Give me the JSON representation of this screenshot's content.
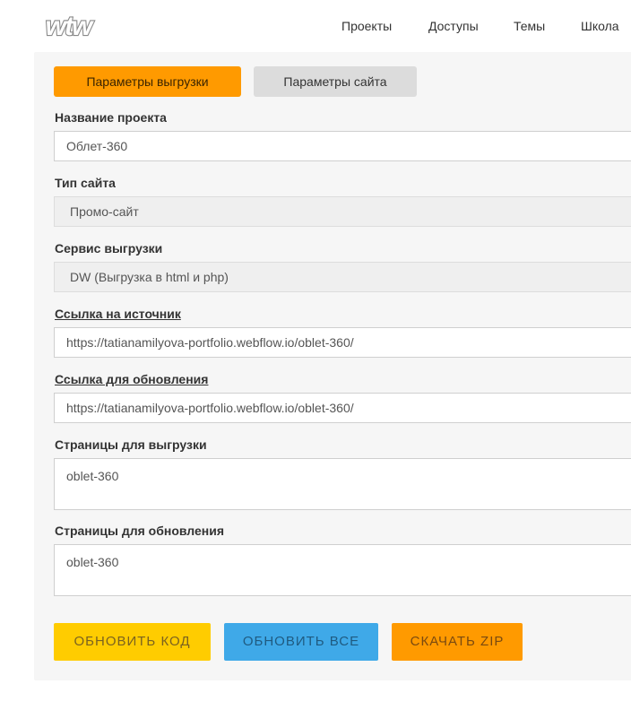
{
  "header": {
    "logo_text": "WTW",
    "nav": [
      "Проекты",
      "Доступы",
      "Темы",
      "Школа"
    ]
  },
  "tabs": {
    "export": "Параметры выгрузки",
    "site": "Параметры сайта"
  },
  "form": {
    "project_name": {
      "label": "Название проекта",
      "value": "Облет-360"
    },
    "site_type": {
      "label": "Тип сайта",
      "value": "Промо-сайт"
    },
    "export_service": {
      "label": "Сервис выгрузки",
      "value": "DW (Выгрузка в html и php)"
    },
    "source_link": {
      "label": "Ссылка на источник",
      "value": "https://tatianamilyova-portfolio.webflow.io/oblet-360/"
    },
    "update_link": {
      "label": "Ссылка для обновления",
      "value": "https://tatianamilyova-portfolio.webflow.io/oblet-360/"
    },
    "export_pages": {
      "label": "Страницы для выгрузки",
      "value": "oblet-360"
    },
    "update_pages": {
      "label": "Страницы для обновления",
      "value": "oblet-360"
    }
  },
  "buttons": {
    "update_code": "ОБНОВИТЬ КОД",
    "update_all": "ОБНОВИТЬ ВСЕ",
    "download_zip": "СКАЧАТЬ ZIP"
  },
  "colors": {
    "accent_orange": "#ff9a00",
    "yellow": "#ffcc00",
    "blue": "#3fa9e8",
    "panel_bg": "#f6f6f6"
  }
}
